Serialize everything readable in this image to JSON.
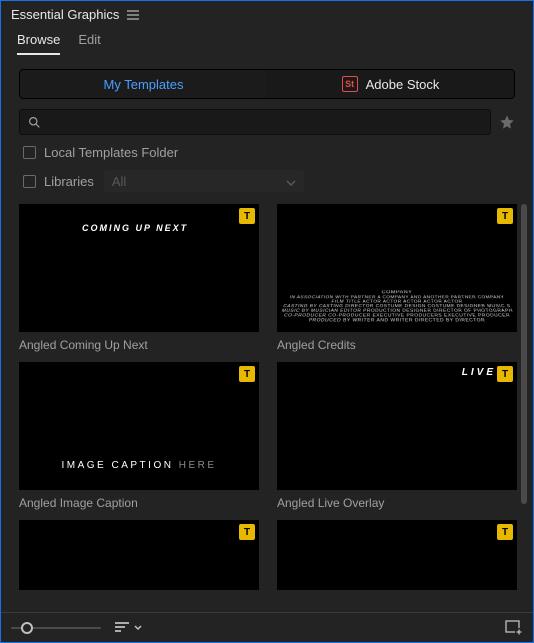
{
  "panel": {
    "title": "Essential Graphics"
  },
  "tabs": {
    "browse": "Browse",
    "edit": "Edit",
    "active": "browse"
  },
  "sources": {
    "my_templates": "My Templates",
    "adobe_stock": "Adobe Stock",
    "stock_badge": "St"
  },
  "search": {
    "value": "",
    "placeholder": ""
  },
  "filters": {
    "local_folder_label": "Local Templates Folder",
    "local_folder_checked": false,
    "libraries_label": "Libraries",
    "libraries_checked": false,
    "libraries_select": "All"
  },
  "templates": [
    {
      "label": "Angled Coming Up Next",
      "kind": "coming-up",
      "text1": "COMING UP NEXT"
    },
    {
      "label": "Angled Credits",
      "kind": "credits",
      "title_line": "COMPANY",
      "lines": [
        "IN ASSOCIATION WITH PARTNER A COMPANY AND ANOTHER PARTNER COMPANY",
        "FILM TITLE    ACTOR   ACTOR   ACTOR   ACTOR   ACTOR",
        "CASTING BY CASTING DIRECTOR  COSTUME DESIGN COSTUME DESIGNER  MUSIC SUPERVISOR MUSIC SUPERVISOR",
        "MUSIC BY MUSICIAN  EDITOR  PRODUCTION DESIGNER  DIRECTOR OF PHOTOGRAPHY DP",
        "CO-PRODUCER CO-PRODUCER  EXECUTIVE PRODUCERS EXECUTIVE PRODUCER",
        "PRODUCED BY WRITER AND WRITER  DIRECTED BY DIRECTOR"
      ]
    },
    {
      "label": "Angled Image Caption",
      "kind": "image-caption",
      "text1": "IMAGE CAPTION",
      "text2": "HERE"
    },
    {
      "label": "Angled Live Overlay",
      "kind": "live",
      "text1": "LIVE"
    },
    {
      "label": "",
      "kind": "blank"
    },
    {
      "label": "",
      "kind": "blank"
    }
  ],
  "icons": {
    "type_badge": "T"
  }
}
